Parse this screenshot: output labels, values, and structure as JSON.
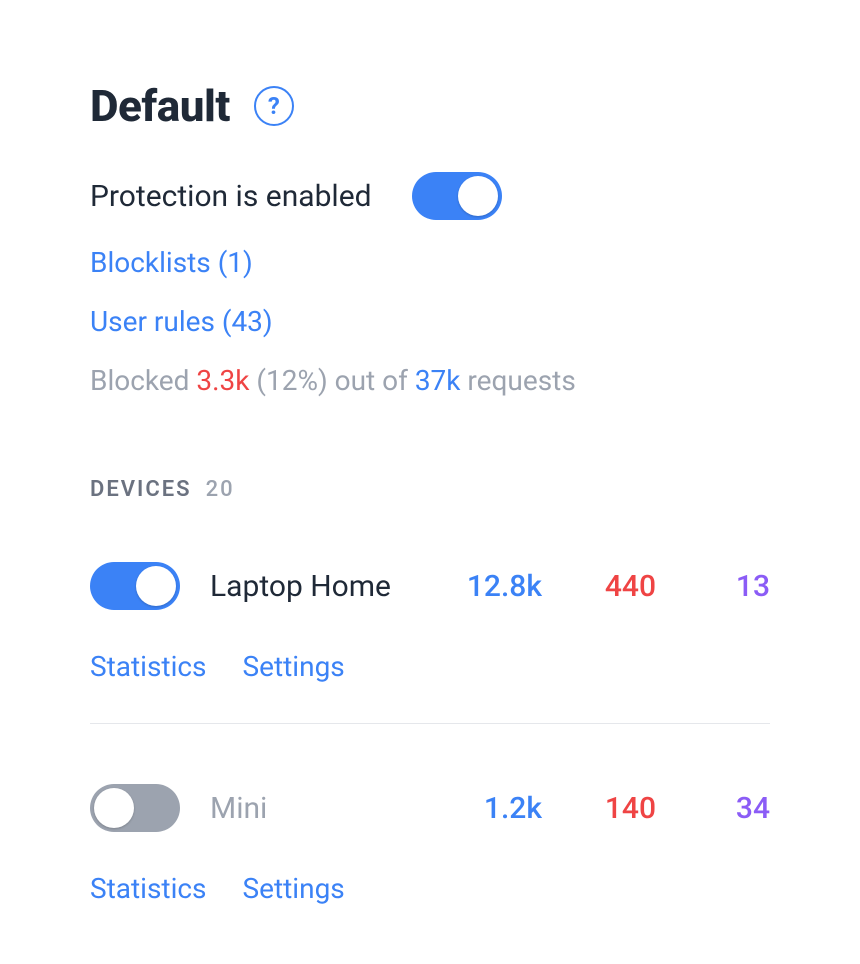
{
  "header": {
    "title": "Default"
  },
  "protection": {
    "status_text": "Protection is enabled",
    "enabled": true
  },
  "links": {
    "blocklists_label": "Blocklists (1)",
    "user_rules_label": "User rules (43)"
  },
  "blocked": {
    "prefix": "Blocked ",
    "blocked_count": "3.3k",
    "percent_suffix": " (12%) out of ",
    "total_count": "37k",
    "tail": " requests"
  },
  "devices_section": {
    "label": "Devices",
    "count": "20"
  },
  "devices": [
    {
      "enabled": true,
      "name": "Laptop Home",
      "stats": {
        "requests": "12.8k",
        "blocked": "440",
        "other": "13"
      },
      "links": {
        "statistics": "Statistics",
        "settings": "Settings"
      }
    },
    {
      "enabled": false,
      "name": "Mini",
      "stats": {
        "requests": "1.2k",
        "blocked": "140",
        "other": "34"
      },
      "links": {
        "statistics": "Statistics",
        "settings": "Settings"
      }
    }
  ]
}
